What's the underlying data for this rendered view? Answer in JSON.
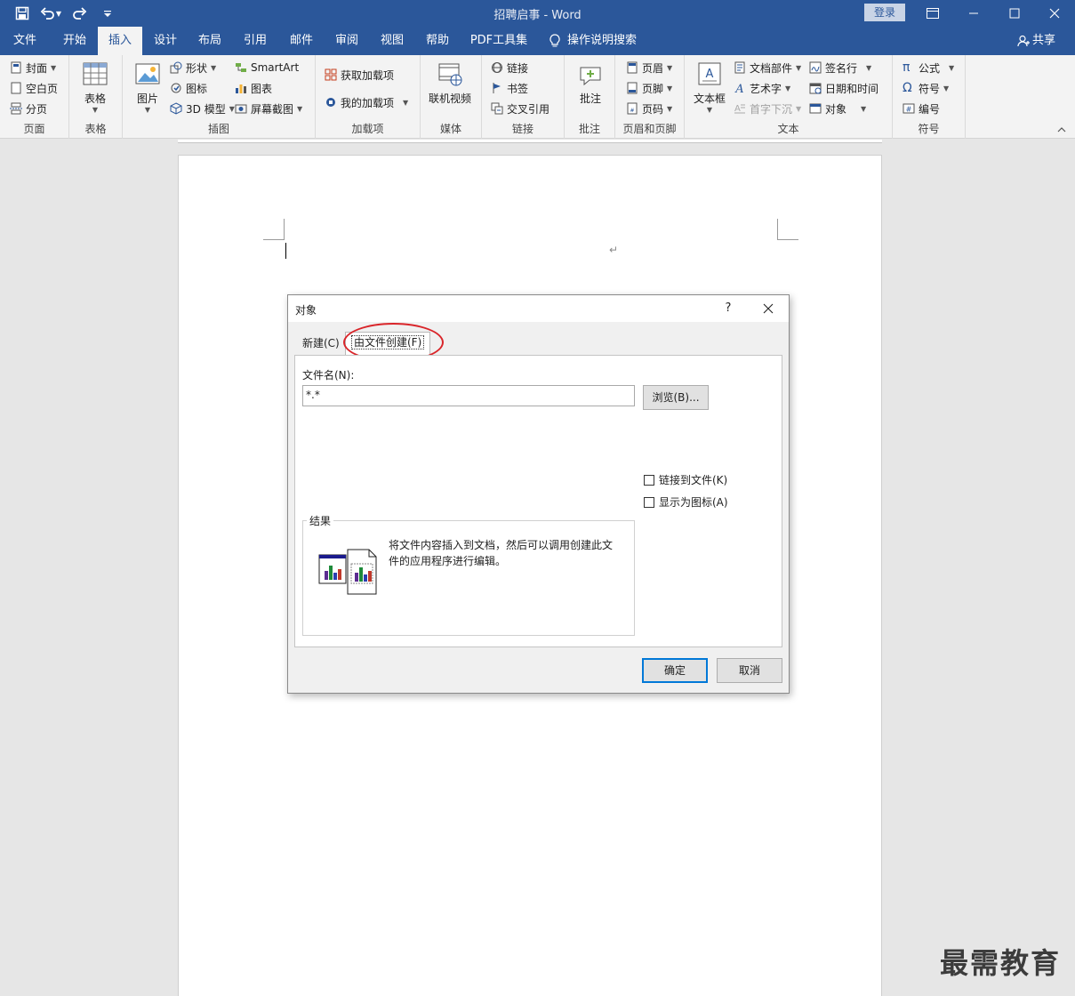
{
  "window": {
    "title": "招聘启事  -  Word",
    "signin": "登录",
    "share": "共享",
    "tell_me": "操作说明搜索"
  },
  "tabs": [
    "文件",
    "开始",
    "插入",
    "设计",
    "布局",
    "引用",
    "邮件",
    "审阅",
    "视图",
    "帮助",
    "PDF工具集"
  ],
  "active_tab": "插入",
  "ribbon": {
    "pages": {
      "label": "页面",
      "cover": "封面",
      "blank": "空白页",
      "break": "分页"
    },
    "tables": {
      "label": "表格",
      "table": "表格"
    },
    "illustrations": {
      "label": "插图",
      "pictures": "图片",
      "shapes": "形状",
      "icons": "图标",
      "model3d": "3D 模型",
      "smartart": "SmartArt",
      "chart": "图表",
      "screenshot": "屏幕截图"
    },
    "addins": {
      "label": "加载项",
      "get": "获取加载项",
      "mine": "我的加载项"
    },
    "media": {
      "label": "媒体",
      "video": "联机视频"
    },
    "links": {
      "label": "链接",
      "link": "链接",
      "bookmark": "书签",
      "crossref": "交叉引用"
    },
    "comments": {
      "label": "批注",
      "comment": "批注"
    },
    "headerfooter": {
      "label": "页眉和页脚",
      "header": "页眉",
      "footer": "页脚",
      "pagenum": "页码"
    },
    "text": {
      "label": "文本",
      "textbox": "文本框",
      "quickparts": "文档部件",
      "wordart": "艺术字",
      "dropcap": "首字下沉",
      "signature": "签名行",
      "datetime": "日期和时间",
      "object": "对象"
    },
    "symbols": {
      "label": "符号",
      "equation": "公式",
      "symbol": "符号",
      "number": "编号"
    }
  },
  "document": {
    "pilcrow": "↵"
  },
  "dialog": {
    "title": "对象",
    "help": "?",
    "tab_new": "新建(C)",
    "tab_from_file": "由文件创建(F)",
    "filename_label": "文件名(N):",
    "filename_value": "*.*",
    "browse": "浏览(B)...",
    "link_to_file": "链接到文件(K)",
    "display_as_icon": "显示为图标(A)",
    "result_label": "结果",
    "result_text": "将文件内容插入到文档，然后可以调用创建此文件的应用程序进行编辑。",
    "ok": "确定",
    "cancel": "取消"
  },
  "watermark": "最需教育",
  "colors": {
    "accent": "#2b579a",
    "highlight_circle": "#d9252a",
    "default_button_border": "#0078d7"
  }
}
